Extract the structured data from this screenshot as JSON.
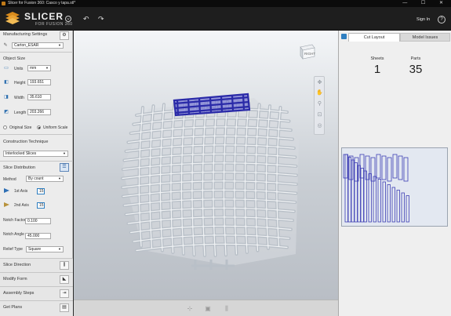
{
  "window": {
    "title": "Slicer for Fusion 360: Casco y tapa.stl*",
    "controls": "—  ☐  ✕"
  },
  "header": {
    "logo_text": "SLICER",
    "logo_sub": "FOR FUSION 360",
    "sign_in": "Sign In",
    "help": "?"
  },
  "left": {
    "manufacturing_settings": "Manufacturing Settings",
    "material": "Carton_ESAR",
    "object_size": "Object Size",
    "units_label": "Units",
    "units_value": "mm",
    "height_label": "Height",
    "height_value": "193.651",
    "width_label": "Width",
    "width_value": "35.610",
    "length_label": "Length",
    "length_value": "203.266",
    "original_size": "Original Size",
    "uniform_scale": "Uniform Scale",
    "construction_technique": "Construction Technique",
    "technique_value": "Interlocked Slices",
    "slice_distribution": "Slice Distribution",
    "method_label": "Method",
    "method_value": "By count",
    "axis1_label": "1st Axis",
    "axis1_value": "15",
    "axis2_label": "2nd Axis",
    "axis2_value": "15",
    "notch_factor_label": "Notch Factor",
    "notch_factor_value": "0.100",
    "notch_angle_label": "Notch Angle",
    "notch_angle_value": "45.000",
    "relief_type_label": "Relief Type",
    "relief_type_value": "Square",
    "bottom_items": [
      "Slice Direction",
      "Modify Form",
      "Assembly Steps",
      "Get Plans"
    ]
  },
  "viewport": {
    "viewcube_label": "RIGHT"
  },
  "right": {
    "tabs": [
      "Cut Layout",
      "Model Issues"
    ],
    "sheets_label": "Sheets",
    "sheets_value": "1",
    "parts_label": "Parts",
    "parts_value": "35"
  },
  "colors": {
    "accent": "#2f7fc1",
    "highlight_slices": "#2a2aa8",
    "slice_gray": "#b9c0c8",
    "layout_parts": "#3d3db5"
  },
  "icons": [
    "minimize-icon",
    "undo-icon",
    "redo-icon",
    "settings-icon",
    "edit-icon",
    "layout-icon",
    "chart-icon",
    "orbit-icon",
    "pan-icon",
    "zoom-icon",
    "zoom-fit-icon",
    "look-at-icon"
  ]
}
